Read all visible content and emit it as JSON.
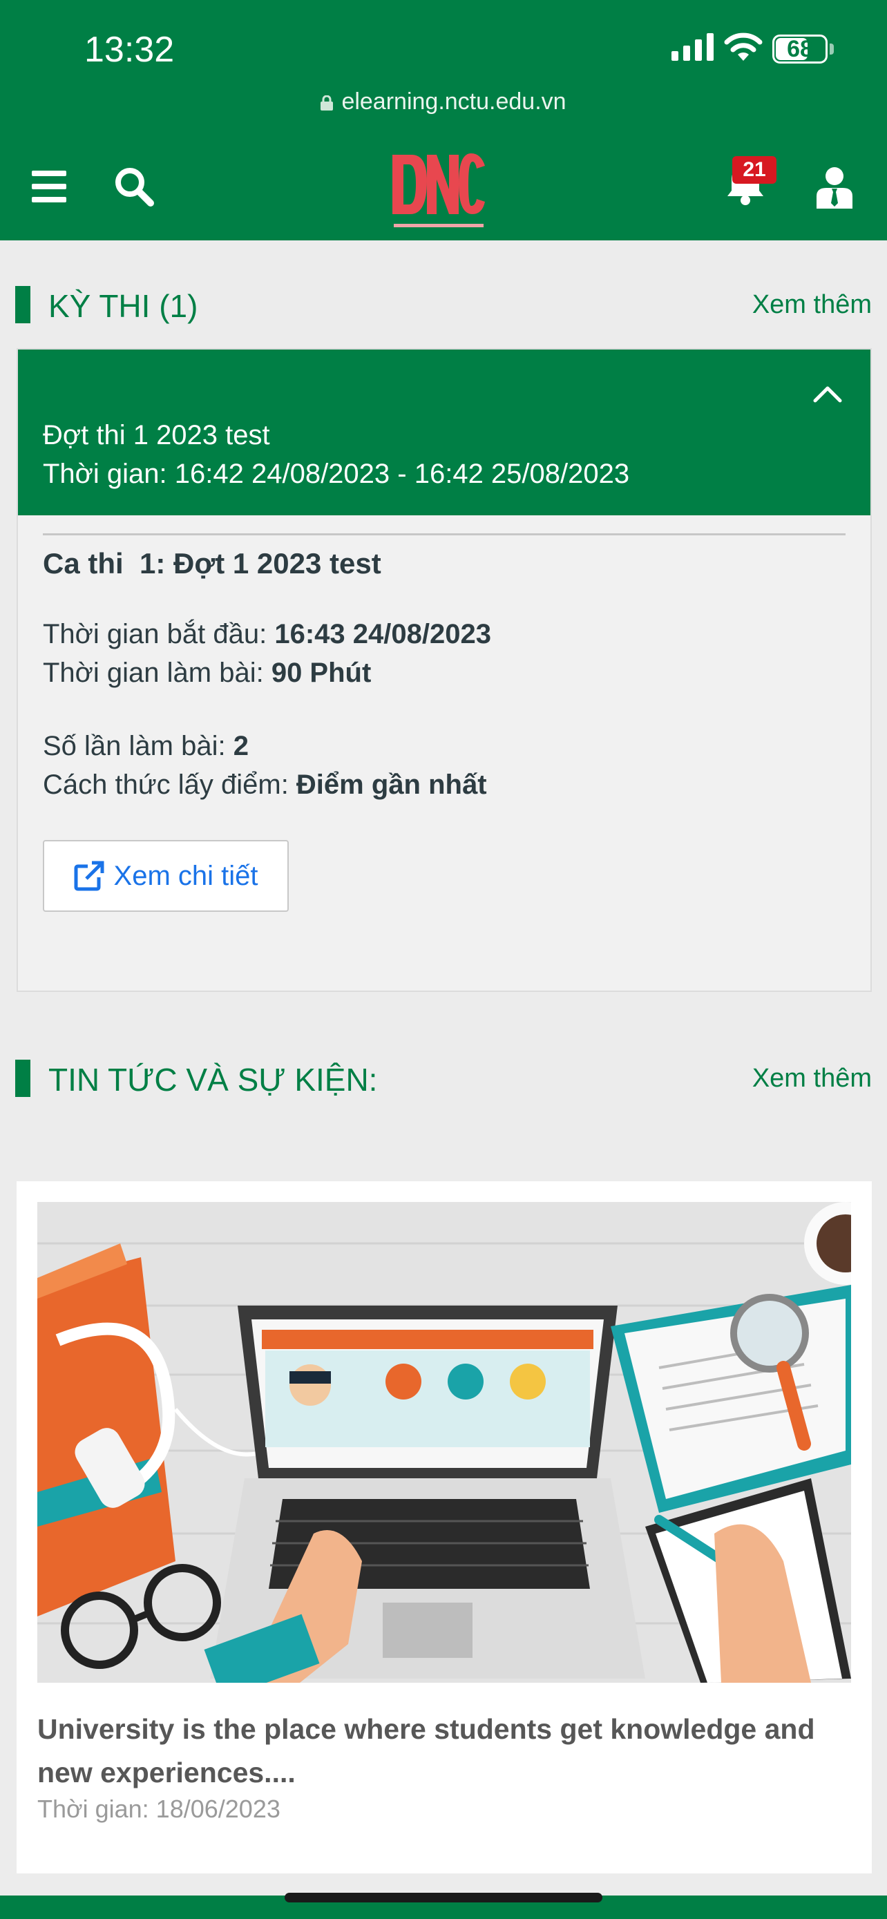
{
  "status_bar": {
    "time": "13:32",
    "battery": "68",
    "battery_level": 0.68
  },
  "browser": {
    "url": "elearning.nctu.edu.vn"
  },
  "header": {
    "notification_count": "21"
  },
  "exam_section": {
    "title": "KỲ THI (1)",
    "see_more": "Xem thêm",
    "exam": {
      "name": "Đợt thi 1 2023 test",
      "time": "Thời gian: 16:42 24/08/2023 - 16:42 25/08/2023",
      "session_title": "Ca thi  1: Đợt 1 2023 test",
      "start_label": "Thời gian bắt đầu: ",
      "start_value": "16:43 24/08/2023",
      "duration_label": "Thời gian làm bài: ",
      "duration_value": "90 Phút",
      "attempts_label": "Số lần làm bài: ",
      "attempts_value": "2",
      "scoring_label": "Cách thức lấy điểm: ",
      "scoring_value": "Điểm gần nhất",
      "detail_button": "Xem chi tiết"
    }
  },
  "news_section": {
    "title": "TIN TỨC VÀ SỰ KIỆN:",
    "see_more": "Xem thêm",
    "items": [
      {
        "title": "University is the place where students get knowledge and new experiences....",
        "date": "Thời gian: 18/06/2023"
      }
    ]
  },
  "colors": {
    "primary": "#007f45",
    "badge": "#d71921",
    "link": "#1a73e8"
  }
}
